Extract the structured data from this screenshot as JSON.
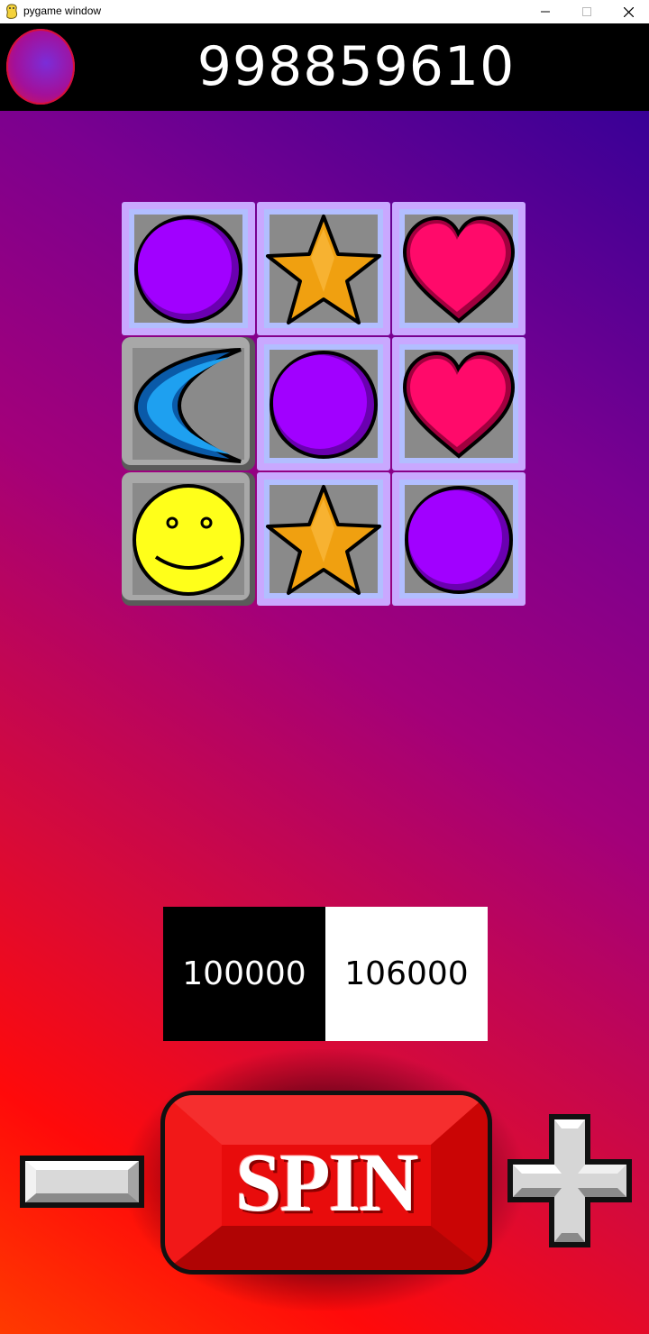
{
  "window": {
    "title": "pygame window",
    "icons": [
      "pygame-snake-icon",
      "minimize-icon",
      "maximize-icon",
      "close-icon"
    ]
  },
  "header": {
    "balance": "998859610",
    "icon": "orb-icon"
  },
  "reels": {
    "rows": [
      [
        {
          "symbol": "purple-circle",
          "highlighted": true
        },
        {
          "symbol": "gold-star",
          "highlighted": true
        },
        {
          "symbol": "pink-heart",
          "highlighted": true
        }
      ],
      [
        {
          "symbol": "blue-moon",
          "highlighted": false
        },
        {
          "symbol": "purple-circle",
          "highlighted": true
        },
        {
          "symbol": "pink-heart",
          "highlighted": true
        }
      ],
      [
        {
          "symbol": "smiley-face",
          "highlighted": false
        },
        {
          "symbol": "gold-star",
          "highlighted": true
        },
        {
          "symbol": "purple-circle",
          "highlighted": true
        }
      ]
    ]
  },
  "bet": {
    "bet_amount": "100000",
    "win_amount": "106000"
  },
  "controls": {
    "spin_label": "SPIN",
    "decrease_icon": "minus-icon",
    "increase_icon": "plus-icon"
  },
  "colors": {
    "bg_bottom_left": "#ff3a00",
    "bg_top_right": "#2a0098",
    "tile": "#8a8a8a",
    "highlight": "#c9a8ff",
    "circle": "#a100ff",
    "star": "#f0a010",
    "heart": "#ff0a6a",
    "moon": "#1ea0f0",
    "smiley": "#ffff1a",
    "spin_button": "#e80c0c"
  }
}
